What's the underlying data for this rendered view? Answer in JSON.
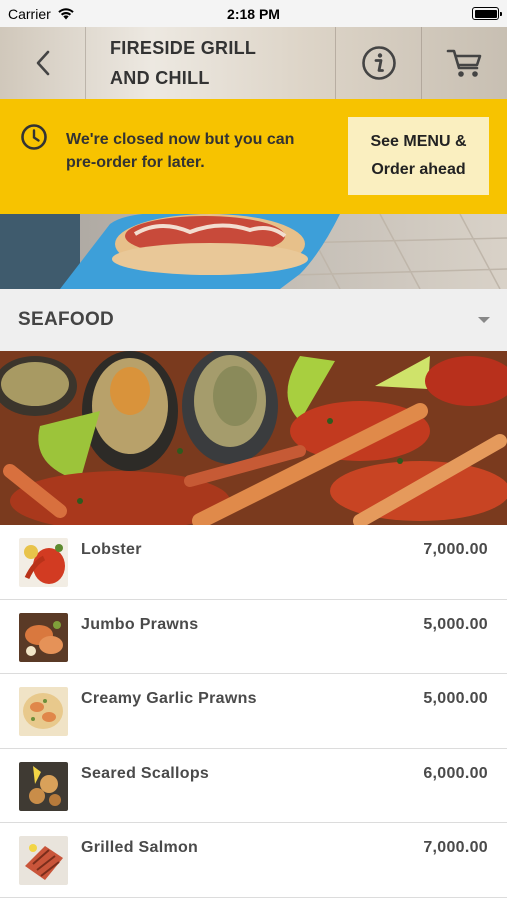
{
  "status_bar": {
    "carrier": "Carrier",
    "time": "2:18 PM"
  },
  "header": {
    "title_line1": "FIRESIDE GRILL",
    "title_line2": "AND CHILL",
    "back_icon": "chevron-left-icon",
    "info_icon": "info-icon",
    "cart_icon": "cart-icon"
  },
  "closed_banner": {
    "message_line1": "We're closed now but you can",
    "message_line2": "pre-order for later.",
    "button_line1": "See MENU &",
    "button_line2": "Order ahead",
    "background_color": "#f7c300",
    "button_color": "#faefc0"
  },
  "category": {
    "title": "SEAFOOD"
  },
  "menu_items": [
    {
      "name": "Lobster",
      "price": "7,000.00"
    },
    {
      "name": "Jumbo Prawns",
      "price": "5,000.00"
    },
    {
      "name": "Creamy Garlic Prawns",
      "price": "5,000.00"
    },
    {
      "name": "Seared Scallops",
      "price": "6,000.00"
    },
    {
      "name": "Grilled Salmon",
      "price": "7,000.00"
    }
  ]
}
